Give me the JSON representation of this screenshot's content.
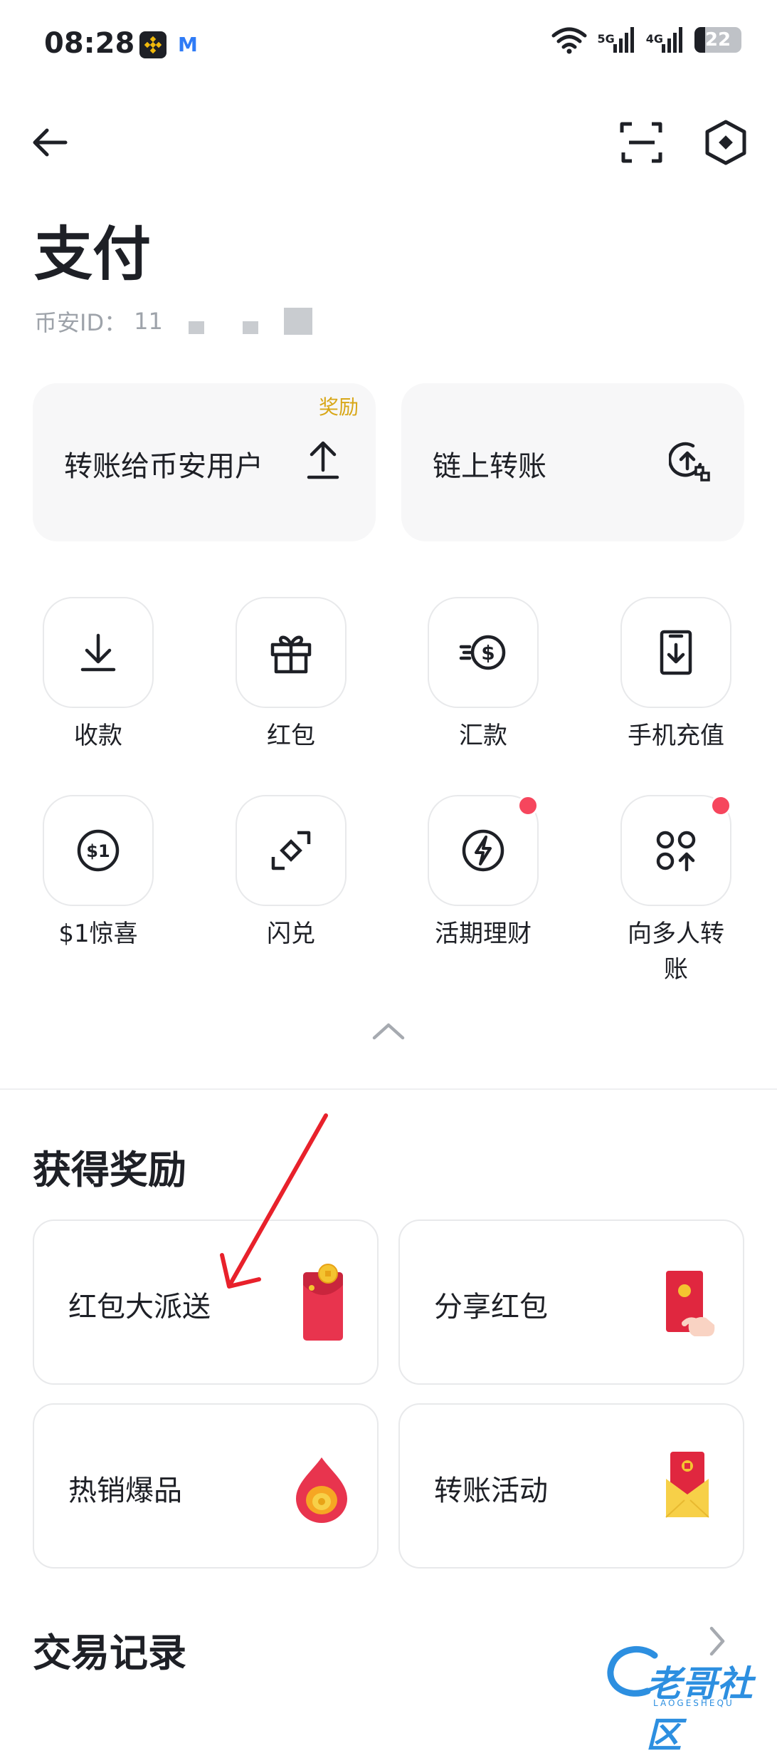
{
  "status_bar": {
    "time": "08:28",
    "signal_1": "5G",
    "signal_2": "4G",
    "battery": "22",
    "battery_level": 0.22
  },
  "header": {
    "title": "支付",
    "account_id_label": "币安ID：",
    "account_id_value": "11"
  },
  "transfer_cards": [
    {
      "label": "转账给币安用户",
      "tag": "奖励"
    },
    {
      "label": "链上转账"
    }
  ],
  "grid": [
    {
      "label": "收款"
    },
    {
      "label": "红包"
    },
    {
      "label": "汇款"
    },
    {
      "label": "手机充值"
    },
    {
      "label": "$1惊喜"
    },
    {
      "label": "闪兑"
    },
    {
      "label": "活期理财"
    },
    {
      "label": "向多人转账"
    }
  ],
  "rewards": {
    "title": "获得奖励",
    "items": [
      {
        "label": "红包大派送"
      },
      {
        "label": "分享红包"
      },
      {
        "label": "热销爆品"
      },
      {
        "label": "转账活动"
      }
    ]
  },
  "transactions": {
    "title": "交易记录"
  },
  "watermark": {
    "text": "老哥社区",
    "sub": "LAOGESHEQU"
  },
  "colors": {
    "accent_gold": "#d8a718",
    "notification_red": "#f6465d",
    "annotation_red": "#e8212b"
  }
}
